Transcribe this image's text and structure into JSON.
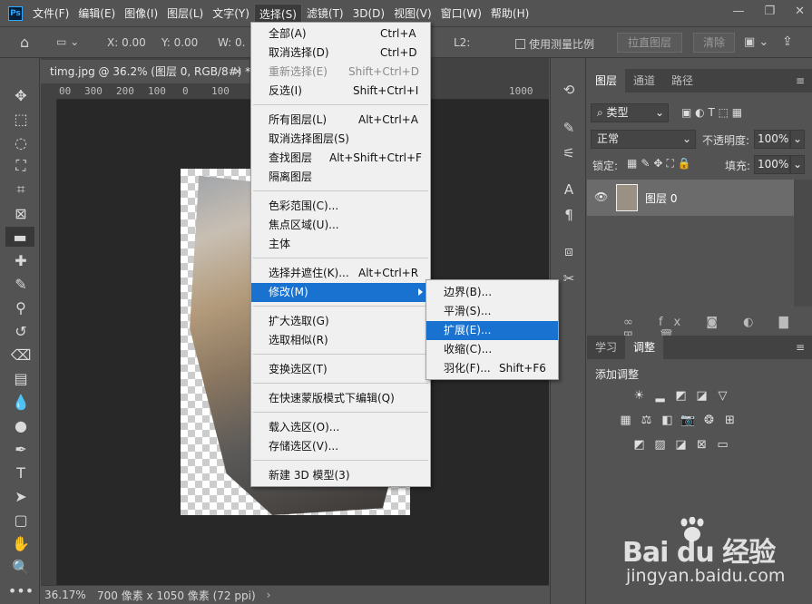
{
  "menubar": {
    "logo": "Ps",
    "items": [
      "文件(F)",
      "编辑(E)",
      "图像(I)",
      "图层(L)",
      "文字(Y)",
      "选择(S)",
      "滤镜(T)",
      "3D(D)",
      "视图(V)",
      "窗口(W)",
      "帮助(H)"
    ],
    "active_index": 5
  },
  "options": {
    "x": "X: 0.00",
    "y": "Y: 0.00",
    "w": "W: 0.",
    "l2": "L2:",
    "measure_scale": "使用测量比例",
    "straighten": "拉直图层",
    "clear": "清除"
  },
  "document": {
    "tab_title": "timg.jpg @ 36.2% (图层 0, RGB/8#) *",
    "ruler_ticks": [
      "00",
      "300",
      "200",
      "100",
      "0",
      "100",
      "1000"
    ],
    "zoom": "36.17%",
    "doc_info": "700 像素 x 1050 像素 (72 ppi)"
  },
  "select_menu": {
    "items": [
      {
        "label": "全部(A)",
        "shortcut": "Ctrl+A",
        "disabled": false
      },
      {
        "label": "取消选择(D)",
        "shortcut": "Ctrl+D",
        "disabled": false
      },
      {
        "label": "重新选择(E)",
        "shortcut": "Shift+Ctrl+D",
        "disabled": true
      },
      {
        "label": "反选(I)",
        "shortcut": "Shift+Ctrl+I",
        "disabled": false
      },
      {
        "label": "所有图层(L)",
        "shortcut": "Alt+Ctrl+A",
        "disabled": false
      },
      {
        "label": "取消选择图层(S)",
        "shortcut": "",
        "disabled": false
      },
      {
        "label": "查找图层",
        "shortcut": "Alt+Shift+Ctrl+F",
        "disabled": false
      },
      {
        "label": "隔离图层",
        "shortcut": "",
        "disabled": false
      },
      {
        "label": "色彩范围(C)...",
        "shortcut": "",
        "disabled": false
      },
      {
        "label": "焦点区域(U)...",
        "shortcut": "",
        "disabled": false
      },
      {
        "label": "主体",
        "shortcut": "",
        "disabled": false
      },
      {
        "label": "选择并遮住(K)...",
        "shortcut": "Alt+Ctrl+R",
        "disabled": false
      },
      {
        "label": "修改(M)",
        "shortcut": "",
        "disabled": false
      },
      {
        "label": "扩大选取(G)",
        "shortcut": "",
        "disabled": false
      },
      {
        "label": "选取相似(R)",
        "shortcut": "",
        "disabled": false
      },
      {
        "label": "变换选区(T)",
        "shortcut": "",
        "disabled": false
      },
      {
        "label": "在快速蒙版模式下编辑(Q)",
        "shortcut": "",
        "disabled": false
      },
      {
        "label": "载入选区(O)...",
        "shortcut": "",
        "disabled": false
      },
      {
        "label": "存储选区(V)...",
        "shortcut": "",
        "disabled": false
      },
      {
        "label": "新建 3D 模型(3)",
        "shortcut": "",
        "disabled": false
      }
    ]
  },
  "modify_submenu": {
    "items": [
      {
        "label": "边界(B)...",
        "shortcut": ""
      },
      {
        "label": "平滑(S)...",
        "shortcut": ""
      },
      {
        "label": "扩展(E)...",
        "shortcut": ""
      },
      {
        "label": "收缩(C)...",
        "shortcut": ""
      },
      {
        "label": "羽化(F)...",
        "shortcut": "Shift+F6"
      }
    ],
    "highlight_index": 2
  },
  "layers_panel": {
    "tabs": [
      "图层",
      "通道",
      "路径"
    ],
    "filter_kind": "类型",
    "blend_mode": "正常",
    "opacity_label": "不透明度:",
    "opacity_value": "100%",
    "lock_label": "锁定:",
    "fill_label": "填充:",
    "fill_value": "100%",
    "layer_name": "图层 0"
  },
  "adjust_panel": {
    "tabs": [
      "学习",
      "调整"
    ],
    "title": "添加调整"
  },
  "watermark": {
    "brand": "Bai du 经验",
    "url": "jingyan.baidu.com"
  },
  "colors": {
    "highlight": "#1a72d0",
    "panel_bg": "#535353",
    "canvas_bg": "#282828"
  }
}
